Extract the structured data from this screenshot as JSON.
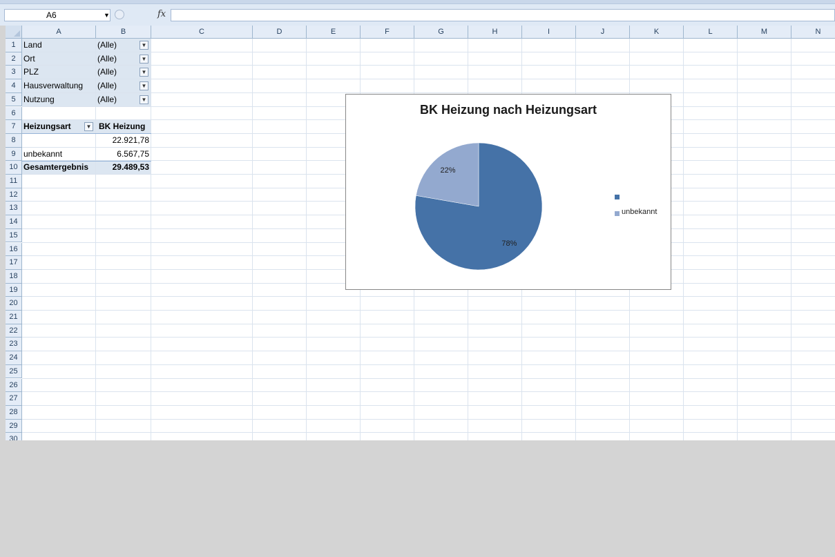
{
  "formula_bar": {
    "name_box": "A6",
    "formula": ""
  },
  "columns": [
    "A",
    "B",
    "C",
    "D",
    "E",
    "F",
    "G",
    "H",
    "I",
    "J",
    "K",
    "L",
    "M",
    "N"
  ],
  "rows": [
    "1",
    "2",
    "3",
    "4",
    "5",
    "6",
    "7",
    "8",
    "9",
    "10",
    "11",
    "12",
    "13",
    "14",
    "15",
    "16",
    "17",
    "18",
    "19",
    "20",
    "21",
    "22",
    "23",
    "24",
    "25",
    "26",
    "27",
    "28",
    "29",
    "30"
  ],
  "filters": [
    {
      "label": "Land",
      "value": "(Alle)"
    },
    {
      "label": "Ort",
      "value": "(Alle)"
    },
    {
      "label": "PLZ",
      "value": "(Alle)"
    },
    {
      "label": "Hausverwaltung",
      "value": "(Alle)"
    },
    {
      "label": "Nutzung",
      "value": "(Alle)"
    }
  ],
  "pivot": {
    "row_header": "Heizungsart",
    "value_header": "BK Heizung",
    "rows": [
      {
        "label": "",
        "value": "22.921,78"
      },
      {
        "label": "unbekannt",
        "value": "6.567,75"
      }
    ],
    "total_label": "Gesamtergebnis",
    "total_value": "29.489,53"
  },
  "chart_data": {
    "type": "pie",
    "title": "BK Heizung nach Heizungsart",
    "categories": [
      "",
      "unbekannt"
    ],
    "values": [
      22921.78,
      6567.75
    ],
    "data_labels": [
      "78%",
      "22%"
    ],
    "colors": [
      "#4572a7",
      "#93a9cf"
    ],
    "legend": "right"
  }
}
